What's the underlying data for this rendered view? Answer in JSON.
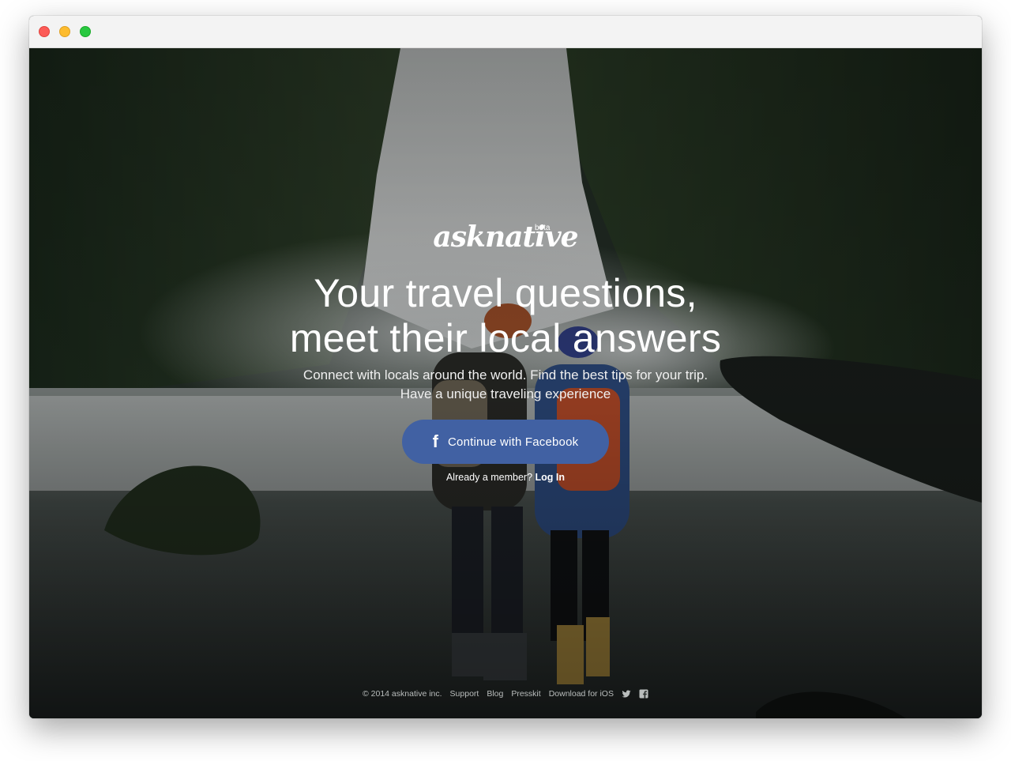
{
  "browser": {
    "buttons": [
      "close",
      "minimize",
      "maximize"
    ]
  },
  "logo": {
    "wordmark": "asknative",
    "badge": "beta"
  },
  "hero": {
    "headline_line1": "Your travel questions,",
    "headline_line2": "meet their local answers",
    "subtitle": "Connect with locals around the world. Find the best tips for your trip. Have a unique traveling experience"
  },
  "cta": {
    "facebook_icon": "f",
    "facebook_label": "Continue with Facebook",
    "member_prompt": "Already a member?",
    "login_label": "Log In"
  },
  "footer": {
    "copyright": "© 2014 asknative inc.",
    "links": [
      "Support",
      "Blog",
      "Presskit",
      "Download for iOS"
    ],
    "social_icons": [
      "twitter-icon",
      "facebook-icon"
    ]
  },
  "colors": {
    "facebook_button": "#4161a3",
    "text": "#ffffff"
  }
}
